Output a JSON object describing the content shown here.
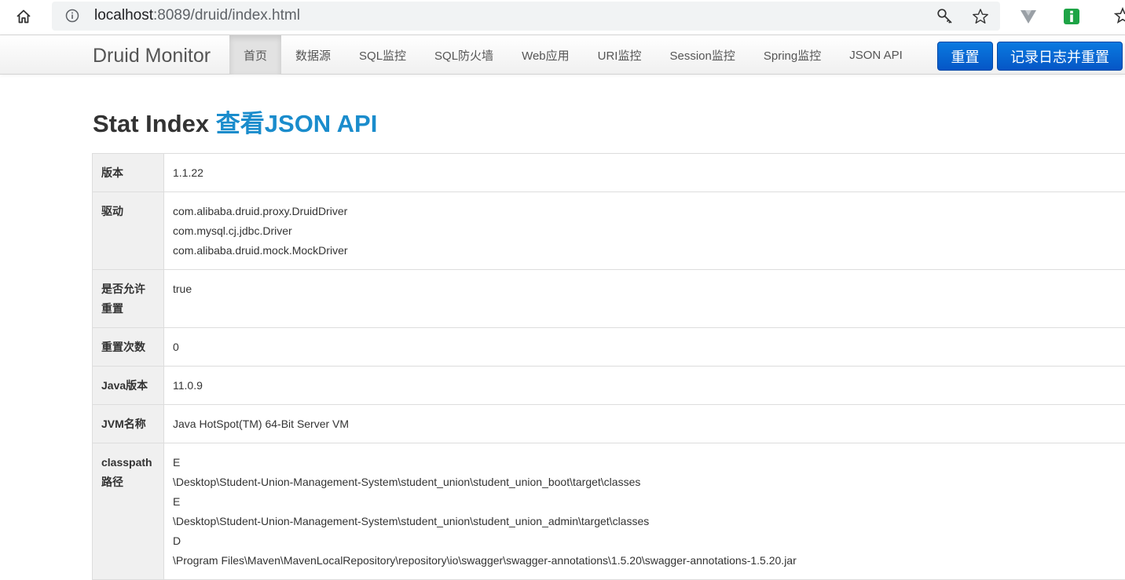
{
  "browser": {
    "url_host": "localhost",
    "url_rest": ":8089/druid/index.html"
  },
  "navbar": {
    "brand": "Druid Monitor",
    "items": [
      {
        "label": "首页",
        "active": true
      },
      {
        "label": "数据源"
      },
      {
        "label": "SQL监控"
      },
      {
        "label": "SQL防火墙"
      },
      {
        "label": "Web应用"
      },
      {
        "label": "URI监控"
      },
      {
        "label": "Session监控"
      },
      {
        "label": "Spring监控"
      },
      {
        "label": "JSON API"
      }
    ],
    "reset_button": "重置",
    "log_reset_button": "记录日志并重置"
  },
  "page": {
    "title": "Stat Index",
    "json_link": "查看JSON API"
  },
  "stats": [
    {
      "label": "版本",
      "values": [
        "1.1.22"
      ]
    },
    {
      "label": "驱动",
      "values": [
        "com.alibaba.druid.proxy.DruidDriver",
        "com.mysql.cj.jdbc.Driver",
        "com.alibaba.druid.mock.MockDriver"
      ]
    },
    {
      "label": "是否允许重置",
      "values": [
        "true"
      ]
    },
    {
      "label": "重置次数",
      "values": [
        "0"
      ]
    },
    {
      "label": "Java版本",
      "values": [
        "11.0.9"
      ]
    },
    {
      "label": "JVM名称",
      "values": [
        "Java HotSpot(TM) 64-Bit Server VM"
      ]
    },
    {
      "label": "classpath路径",
      "values": [
        "E",
        "\\Desktop\\Student-Union-Management-System\\student_union\\student_union_boot\\target\\classes",
        "E",
        "\\Desktop\\Student-Union-Management-System\\student_union\\student_union_admin\\target\\classes",
        "D",
        "\\Program Files\\Maven\\MavenLocalRepository\\repository\\io\\swagger\\swagger-annotations\\1.5.20\\swagger-annotations-1.5.20.jar"
      ]
    }
  ],
  "colors": {
    "link": "#1a8ccc",
    "primary_button": "#0556c6"
  }
}
